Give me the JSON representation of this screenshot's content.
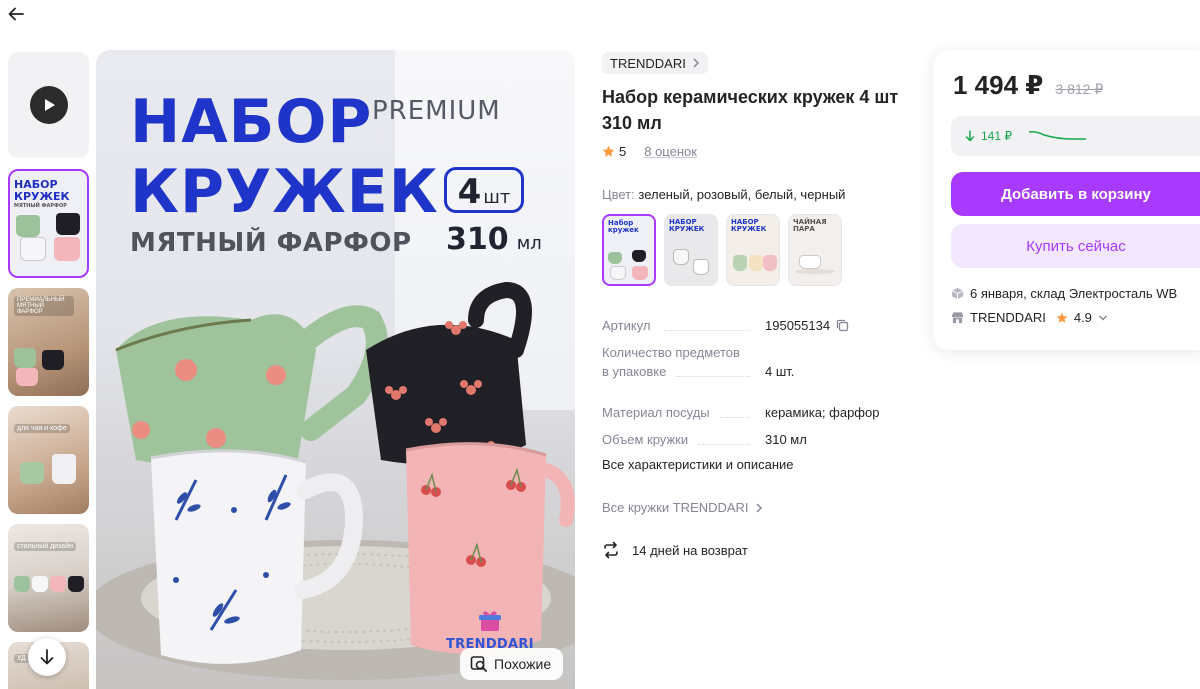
{
  "nav": {
    "back_icon": "arrow-left-icon"
  },
  "gallery": {
    "thumb_captions": [
      "ПРЕМИАЛЬНЫЙ МЯТНЫЙ ФАРФОР",
      "для чая и кофе",
      "стильный дизайн",
      "УД"
    ],
    "thumb1_title": [
      "НАБОР",
      "КРУЖЕК",
      "МЯТНЫЙ ФАРФОР"
    ]
  },
  "main_image": {
    "title_line1": "НАБОР",
    "premium": "PREMIUM",
    "title_line2": "КРУЖЕК",
    "subtitle": "МЯТНЫЙ ФАРФОР",
    "count_number": "4",
    "count_unit": "шт",
    "volume_number": "310",
    "volume_unit": "мл",
    "logo_text": "TRENDDARI",
    "similar_label": "Похожие"
  },
  "product": {
    "brand": "TRENDDARI",
    "title": "Набор керамических кружек 4 шт 310 мл",
    "rating": "5",
    "reviews": "8 оценок",
    "color_label": "Цвет:",
    "color_value": "зеленый, розовый, белый, черный",
    "swatch_titles": [
      "Набор кружек",
      "НАБОР КРУЖЕК",
      "НАБОР КРУЖЕК",
      "ЧАЙНАЯ ПАРА"
    ],
    "specs": [
      {
        "name": "Артикул",
        "value": "195055134"
      },
      {
        "name": "Количество предметов",
        "name2": "в упаковке",
        "value": "4 шт."
      },
      {
        "name": "Материал посуды",
        "value": "керамика; фарфор"
      },
      {
        "name": "Объем кружки",
        "value": "310 мл"
      }
    ],
    "all_specs": "Все характеристики и описание",
    "all_brand": "Все кружки TRENDDARI",
    "returns": "14 дней на возврат"
  },
  "price_card": {
    "price": "1 494 ₽",
    "old_price": "3 812 ₽",
    "price_drop": "141 ₽",
    "add_to_cart": "Добавить в корзину",
    "buy_now": "Купить сейчас",
    "delivery": "6 января, склад Электросталь WB",
    "seller": "TRENDDARI",
    "seller_rating": "4.9"
  },
  "colors": {
    "accent": "#a73afd",
    "accent_light": "#f3e6ff",
    "brand_blue": "#1f35c9",
    "price_drop_green": "#14a84a",
    "star": "#ff9a3e"
  }
}
